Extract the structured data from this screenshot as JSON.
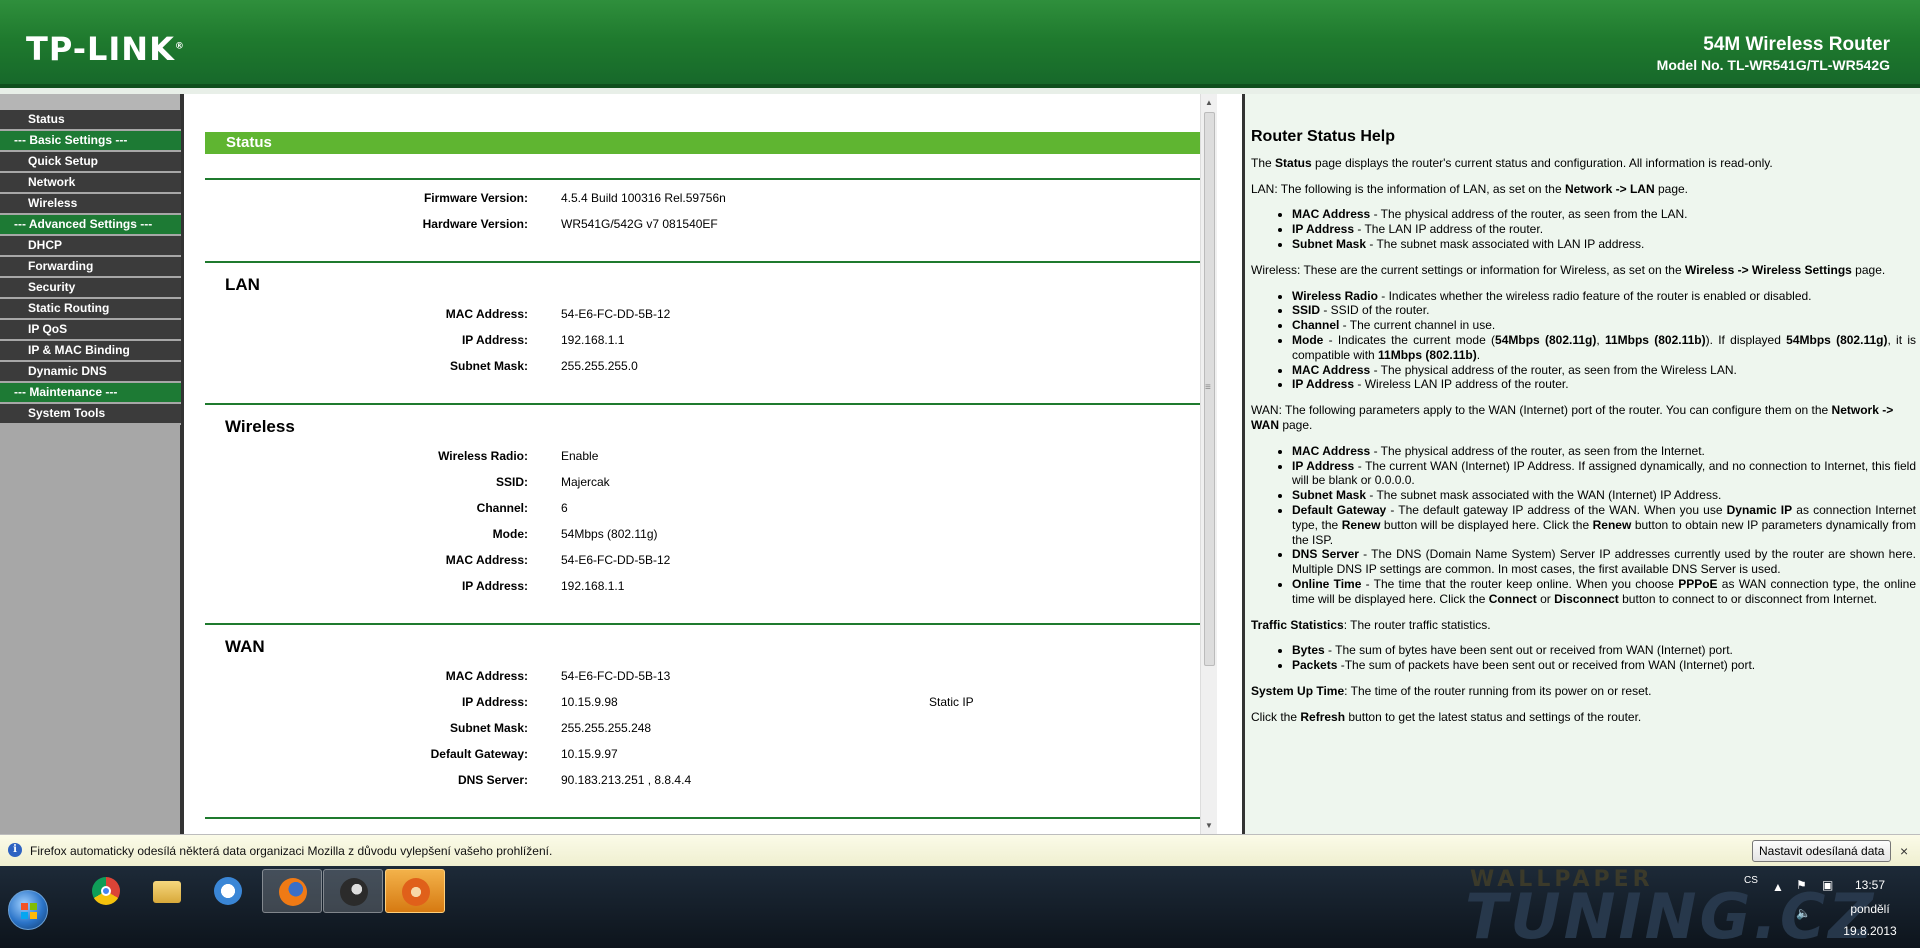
{
  "header": {
    "logo": "TP-LINK",
    "logo_mark": "®",
    "product": "54M Wireless Router",
    "model": "Model No. TL-WR541G/TL-WR542G"
  },
  "menu": {
    "items": [
      {
        "label": "Status",
        "section": false
      },
      {
        "label": "--- Basic Settings ---",
        "section": true
      },
      {
        "label": "Quick Setup",
        "section": false
      },
      {
        "label": "Network",
        "section": false
      },
      {
        "label": "Wireless",
        "section": false
      },
      {
        "label": "--- Advanced Settings ---",
        "section": true
      },
      {
        "label": "DHCP",
        "section": false
      },
      {
        "label": "Forwarding",
        "section": false
      },
      {
        "label": "Security",
        "section": false
      },
      {
        "label": "Static Routing",
        "section": false
      },
      {
        "label": "IP QoS",
        "section": false
      },
      {
        "label": "IP & MAC Binding",
        "section": false
      },
      {
        "label": "Dynamic DNS",
        "section": false
      },
      {
        "label": "--- Maintenance ---",
        "section": true
      },
      {
        "label": "System Tools",
        "section": false
      }
    ]
  },
  "status": {
    "title": "Status",
    "firmware_label": "Firmware Version:",
    "firmware_value": "4.5.4 Build 100316 Rel.59756n",
    "hardware_label": "Hardware Version:",
    "hardware_value": "WR541G/542G v7 081540EF",
    "lan": {
      "title": "LAN",
      "rows": [
        {
          "label": "MAC Address:",
          "value": "54-E6-FC-DD-5B-12"
        },
        {
          "label": "IP Address:",
          "value": "192.168.1.1"
        },
        {
          "label": "Subnet Mask:",
          "value": "255.255.255.0"
        }
      ]
    },
    "wireless": {
      "title": "Wireless",
      "rows": [
        {
          "label": "Wireless Radio:",
          "value": "Enable"
        },
        {
          "label": "SSID:",
          "value": "Majercak"
        },
        {
          "label": "Channel:",
          "value": "6"
        },
        {
          "label": "Mode:",
          "value": "54Mbps (802.11g)"
        },
        {
          "label": "MAC Address:",
          "value": "54-E6-FC-DD-5B-12"
        },
        {
          "label": "IP Address:",
          "value": "192.168.1.1"
        }
      ]
    },
    "wan": {
      "title": "WAN",
      "rows": [
        {
          "label": "MAC Address:",
          "value": "54-E6-FC-DD-5B-13",
          "extra": ""
        },
        {
          "label": "IP Address:",
          "value": "10.15.9.98",
          "extra": "Static IP"
        },
        {
          "label": "Subnet Mask:",
          "value": "255.255.255.248",
          "extra": ""
        },
        {
          "label": "Default Gateway:",
          "value": "10.15.9.97",
          "extra": ""
        },
        {
          "label": "DNS Server:",
          "value": "90.183.213.251 , 8.8.4.4",
          "extra": ""
        }
      ]
    }
  },
  "help": {
    "title": "Router Status Help",
    "intro_a": "The ",
    "intro_b": "Status",
    "intro_c": " page displays the router's current status and configuration. All information is read-only.",
    "lan_a": "LAN",
    "lan_b": ": The following is the information of LAN, as set on the ",
    "lan_c": "Network -> LAN",
    "lan_d": " page.",
    "lan_items": [
      {
        "term": "MAC Address",
        "desc": " - The physical address of the router, as seen from the LAN."
      },
      {
        "term": "IP Address",
        "desc": " - The LAN IP address of the router."
      },
      {
        "term": "Subnet Mask",
        "desc": " - The subnet mask associated with LAN IP address."
      }
    ],
    "wl_a": "Wireless",
    "wl_b": ": These are the current settings or information for Wireless, as set on the ",
    "wl_c": "Wireless -> Wireless Settings",
    "wl_d": " page.",
    "wl_items": [
      {
        "term": "Wireless Radio",
        "desc": " - Indicates whether the wireless radio feature of the router is enabled or disabled."
      },
      {
        "term": "SSID",
        "desc": " - SSID of the router."
      },
      {
        "term": "Channel",
        "desc": " - The current channel in use."
      }
    ],
    "wl_mode": {
      "t1": "Mode",
      "t2": " - Indicates the current mode (",
      "t3": "54Mbps (802.11g)",
      "t4": ", ",
      "t5": "11Mbps (802.11b)",
      "t6": "). If displayed ",
      "t7": "54Mbps (802.11g)",
      "t8": ", it is compatible with ",
      "t9": "11Mbps (802.11b)",
      "t10": "."
    },
    "wl_items2": [
      {
        "term": "MAC Address",
        "desc": " - The physical address of the router, as seen from the Wireless LAN."
      },
      {
        "term": "IP Address",
        "desc": " - Wireless LAN IP address of the router."
      }
    ],
    "wan_a": "WAN",
    "wan_b": ": The following parameters apply to the WAN (Internet) port of the router. You can configure them on the ",
    "wan_c": "Network -> WAN",
    "wan_d": " page.",
    "wan_items": [
      {
        "term": "MAC Address",
        "desc": " - The physical address of the router, as seen from the Internet."
      },
      {
        "term": "IP Address",
        "desc": " - The current WAN (Internet) IP Address. If assigned dynamically, and no connection to Internet, this field will be blank or 0.0.0.0."
      },
      {
        "term": "Subnet Mask",
        "desc": " - The subnet mask associated with the WAN (Internet) IP Address."
      }
    ],
    "wan_gw": {
      "t1": "Default Gateway",
      "t2": " - The default gateway IP address of the WAN. When you use ",
      "t3": "Dynamic IP",
      "t4": " as connection Internet type, the ",
      "t5": "Renew",
      "t6": " button will be displayed here. Click the ",
      "t7": "Renew",
      "t8": " button to obtain new IP parameters dynamically from the ISP."
    },
    "wan_dns": {
      "t1": "DNS Server",
      "t2": " - The DNS (Domain Name System) Server IP addresses currently used by the router are shown here. Multiple DNS IP settings are common. In most cases, the first available DNS Server is used."
    },
    "wan_ot": {
      "t1": "Online Time",
      "t2": " - The time that the router keep online. When you choose ",
      "t3": "PPPoE",
      "t4": " as WAN connection type, the online time will be displayed here. Click the ",
      "t5": "Connect",
      "t6": " or ",
      "t7": "Disconnect",
      "t8": " button to connect to or disconnect from Internet."
    },
    "ts_a": "Traffic Statistics",
    "ts_b": ": The router traffic statistics.",
    "ts_items": [
      {
        "term": "Bytes",
        "desc": " - The sum of bytes have been sent out or received from WAN (Internet) port."
      },
      {
        "term": "Packets",
        "desc": " -The sum of packets have been sent out or received from WAN (Internet) port."
      }
    ],
    "up_a": "System Up Time",
    "up_b": ": The time of the router running from its power on or reset.",
    "ref_a": "Click the ",
    "ref_b": "Refresh",
    "ref_c": " button to get the latest status and settings of the router."
  },
  "notification": {
    "text": "Firefox automaticky odesílá některá data organizaci Mozilla z důvodu vylepšení vašeho prohlížení.",
    "button": "Nastavit odesílaná data",
    "close": "×"
  },
  "taskbar": {
    "wallpaper_top": "WALLPAPER",
    "wallpaper_text": "TUNING.CZ",
    "lang": "CS",
    "time": "13:57",
    "day": "pondělí",
    "date": "19.8.2013"
  }
}
